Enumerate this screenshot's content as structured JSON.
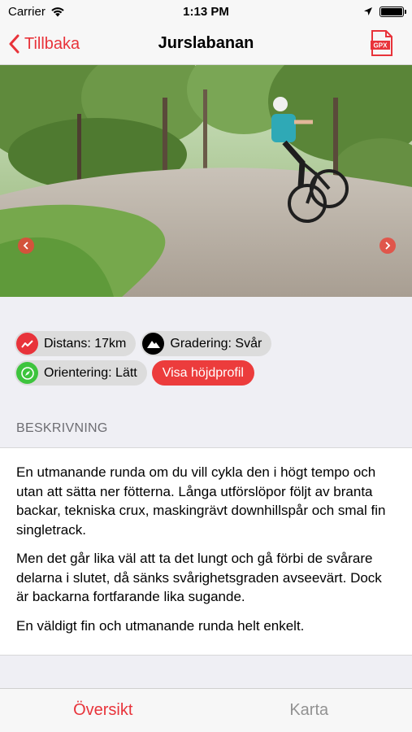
{
  "status_bar": {
    "carrier": "Carrier",
    "time": "1:13 PM",
    "icons": [
      "wifi-icon",
      "location-arrow-icon",
      "battery-icon"
    ]
  },
  "nav": {
    "back_label": "Tillbaka",
    "title": "Jurslabanan",
    "gpx_label": "GPX",
    "accent_color": "#e8333a"
  },
  "hero": {
    "description_icons": [
      "chevron-left-icon",
      "chevron-right-icon"
    ]
  },
  "tags": {
    "distance": "Distans: 17km",
    "grading": "Gradering: Svår",
    "orientation": "Orientering: Lätt",
    "elevation_button": "Visa höjdprofil",
    "colors": {
      "distance_icon": "#e8333a",
      "grading_icon": "#000000",
      "orientation_icon": "#3dc43d",
      "action_button": "#ec3c3c"
    }
  },
  "section": {
    "description_header": "BESKRIVNING"
  },
  "description": {
    "paragraphs": [
      "En utmanande runda om du vill cykla den i högt tempo och utan att sätta ner fötterna. Långa utförslöpor följt av branta backar, tekniska crux, maskingrävt downhillspår och smal fin singletrack.",
      "Men det går lika väl att ta det lungt och gå förbi de svårare delarna i slutet, då sänks svårighetsgraden avseevärt. Dock är backarna fortfarande lika sugande.",
      "En väldigt fin och utmanande runda helt enkelt."
    ]
  },
  "tab_bar": {
    "overview": "Översikt",
    "map": "Karta"
  }
}
